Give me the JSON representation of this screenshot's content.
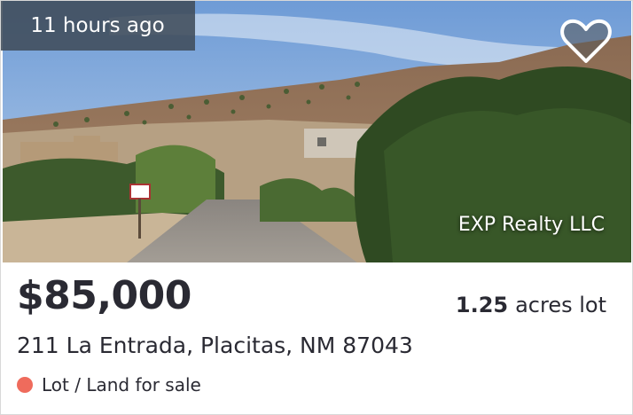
{
  "listing": {
    "time_badge": "11 hours ago",
    "agency": "EXP Realty LLC",
    "price": "$85,000",
    "lot_size_value": "1.25",
    "lot_size_unit": "acres lot",
    "address": "211 La Entrada, Placitas, NM 87043",
    "status": "Lot / Land for sale",
    "status_color": "#ef6b5c",
    "favorite_icon": "heart-icon"
  }
}
